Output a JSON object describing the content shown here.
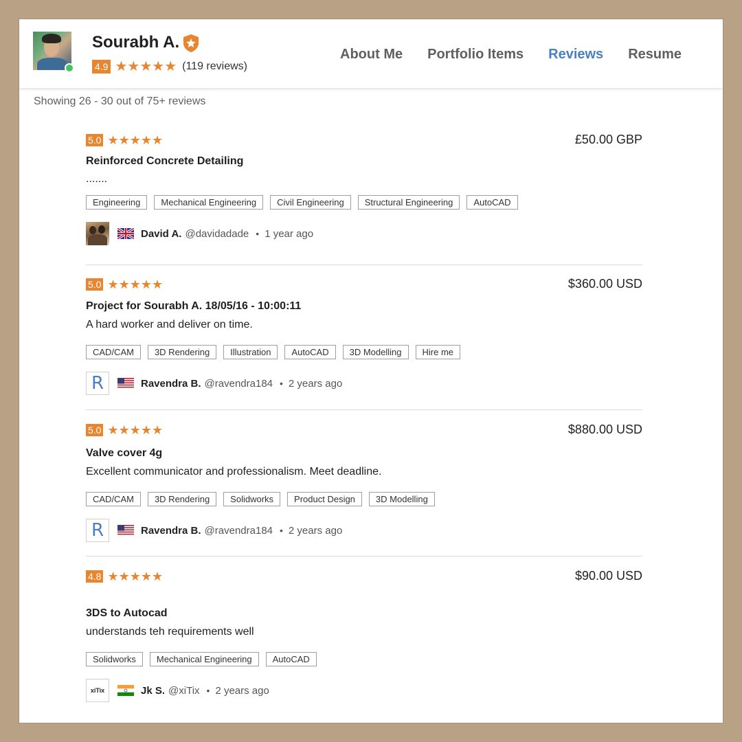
{
  "profile": {
    "name": "Sourabh A.",
    "rating": "4.9",
    "reviews_count": "(119 reviews)"
  },
  "nav": [
    {
      "label": "About Me"
    },
    {
      "label": "Portfolio Items"
    },
    {
      "label": "Reviews"
    },
    {
      "label": "Resume"
    }
  ],
  "active_tab": "Reviews",
  "showing": "Showing 26 - 30 out of 75+ reviews",
  "colors": {
    "accent_orange": "#e8862f",
    "link_blue": "#4a7fc4",
    "frame": "#b9a185"
  },
  "reviews": [
    {
      "score": "5.0",
      "price": "£50.00 GBP",
      "title": "Reinforced Concrete Detailing",
      "desc": ".......",
      "tags": [
        "Engineering",
        "Mechanical Engineering",
        "Civil Engineering",
        "Structural Engineering",
        "AutoCAD"
      ],
      "reviewer": {
        "name": "David A.",
        "handle": "@davidadade",
        "ago": "1 year ago",
        "flag": "uk-flag",
        "avatar": "photo"
      }
    },
    {
      "score": "5.0",
      "price": "$360.00 USD",
      "title": "Project for Sourabh A. 18/05/16 - 10:00:11",
      "desc": "A hard worker and deliver on time.",
      "tags": [
        "CAD/CAM",
        "3D Rendering",
        "Illustration",
        "AutoCAD",
        "3D Modelling",
        "Hire me"
      ],
      "reviewer": {
        "name": "Ravendra B.",
        "handle": "@ravendra184",
        "ago": "2 years ago",
        "flag": "us-flag",
        "avatar_letter": "R"
      }
    },
    {
      "score": "5.0",
      "price": "$880.00 USD",
      "title": "Valve cover 4g",
      "desc": "Excellent communicator and professionalism. Meet deadline.",
      "tags": [
        "CAD/CAM",
        "3D Rendering",
        "Solidworks",
        "Product Design",
        "3D Modelling"
      ],
      "reviewer": {
        "name": "Ravendra B.",
        "handle": "@ravendra184",
        "ago": "2 years ago",
        "flag": "us-flag",
        "avatar_letter": "R"
      }
    },
    {
      "score": "4.8",
      "price": "$90.00 USD",
      "title": "3DS to Autocad",
      "desc": "understands teh requirements well",
      "tags": [
        "Solidworks",
        "Mechanical Engineering",
        "AutoCAD"
      ],
      "reviewer": {
        "name": "Jk S.",
        "handle": "@xiTix",
        "ago": "2 years ago",
        "flag": "india-flag",
        "avatar_logo": "xiTix"
      }
    }
  ],
  "stars": "★★★★★",
  "bullet": "•"
}
